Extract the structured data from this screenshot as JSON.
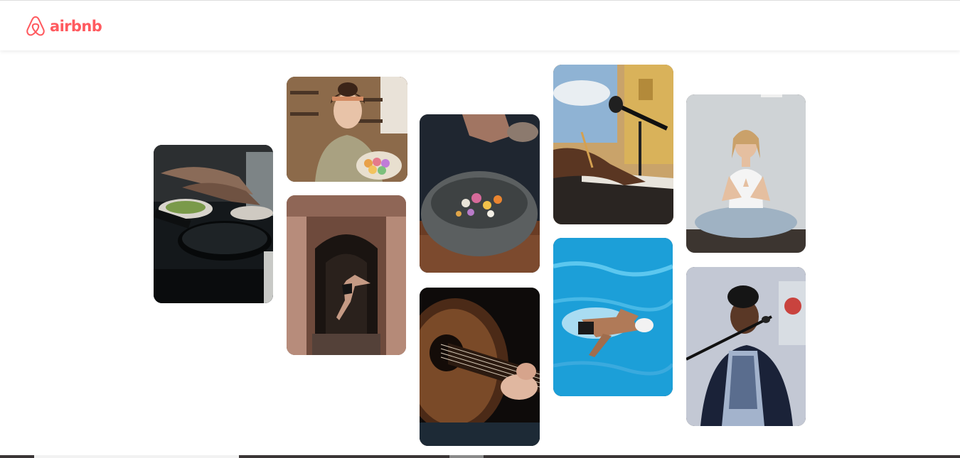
{
  "brand": {
    "name": "airbnb",
    "color": "#FF5A5F"
  },
  "tiles": [
    {
      "icon": "cooking-photo"
    },
    {
      "icon": "macaron-baker-photo"
    },
    {
      "icon": "dancer-doorway-photo"
    },
    {
      "icon": "food-bowl-photo"
    },
    {
      "icon": "acoustic-guitar-photo"
    },
    {
      "icon": "keyboard-microphone-photo"
    },
    {
      "icon": "swimmer-pool-photo"
    },
    {
      "icon": "yoga-meditation-photo"
    },
    {
      "icon": "singer-microphone-photo"
    }
  ]
}
